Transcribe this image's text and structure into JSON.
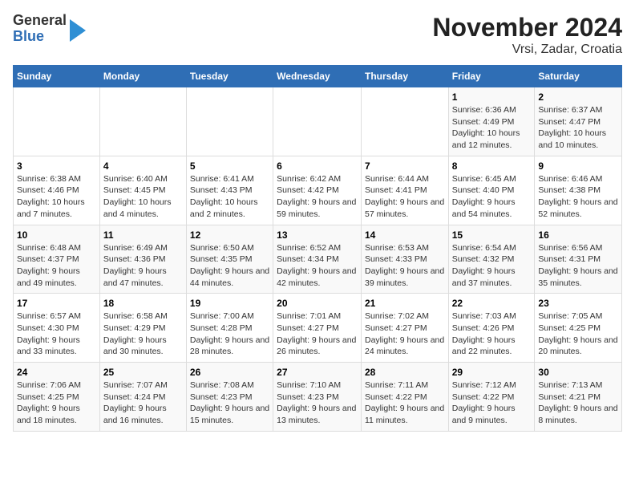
{
  "header": {
    "logo_general": "General",
    "logo_blue": "Blue",
    "title": "November 2024",
    "subtitle": "Vrsi, Zadar, Croatia"
  },
  "calendar": {
    "days_of_week": [
      "Sunday",
      "Monday",
      "Tuesday",
      "Wednesday",
      "Thursday",
      "Friday",
      "Saturday"
    ],
    "weeks": [
      [
        {
          "day": "",
          "info": ""
        },
        {
          "day": "",
          "info": ""
        },
        {
          "day": "",
          "info": ""
        },
        {
          "day": "",
          "info": ""
        },
        {
          "day": "",
          "info": ""
        },
        {
          "day": "1",
          "info": "Sunrise: 6:36 AM\nSunset: 4:49 PM\nDaylight: 10 hours and 12 minutes."
        },
        {
          "day": "2",
          "info": "Sunrise: 6:37 AM\nSunset: 4:47 PM\nDaylight: 10 hours and 10 minutes."
        }
      ],
      [
        {
          "day": "3",
          "info": "Sunrise: 6:38 AM\nSunset: 4:46 PM\nDaylight: 10 hours and 7 minutes."
        },
        {
          "day": "4",
          "info": "Sunrise: 6:40 AM\nSunset: 4:45 PM\nDaylight: 10 hours and 4 minutes."
        },
        {
          "day": "5",
          "info": "Sunrise: 6:41 AM\nSunset: 4:43 PM\nDaylight: 10 hours and 2 minutes."
        },
        {
          "day": "6",
          "info": "Sunrise: 6:42 AM\nSunset: 4:42 PM\nDaylight: 9 hours and 59 minutes."
        },
        {
          "day": "7",
          "info": "Sunrise: 6:44 AM\nSunset: 4:41 PM\nDaylight: 9 hours and 57 minutes."
        },
        {
          "day": "8",
          "info": "Sunrise: 6:45 AM\nSunset: 4:40 PM\nDaylight: 9 hours and 54 minutes."
        },
        {
          "day": "9",
          "info": "Sunrise: 6:46 AM\nSunset: 4:38 PM\nDaylight: 9 hours and 52 minutes."
        }
      ],
      [
        {
          "day": "10",
          "info": "Sunrise: 6:48 AM\nSunset: 4:37 PM\nDaylight: 9 hours and 49 minutes."
        },
        {
          "day": "11",
          "info": "Sunrise: 6:49 AM\nSunset: 4:36 PM\nDaylight: 9 hours and 47 minutes."
        },
        {
          "day": "12",
          "info": "Sunrise: 6:50 AM\nSunset: 4:35 PM\nDaylight: 9 hours and 44 minutes."
        },
        {
          "day": "13",
          "info": "Sunrise: 6:52 AM\nSunset: 4:34 PM\nDaylight: 9 hours and 42 minutes."
        },
        {
          "day": "14",
          "info": "Sunrise: 6:53 AM\nSunset: 4:33 PM\nDaylight: 9 hours and 39 minutes."
        },
        {
          "day": "15",
          "info": "Sunrise: 6:54 AM\nSunset: 4:32 PM\nDaylight: 9 hours and 37 minutes."
        },
        {
          "day": "16",
          "info": "Sunrise: 6:56 AM\nSunset: 4:31 PM\nDaylight: 9 hours and 35 minutes."
        }
      ],
      [
        {
          "day": "17",
          "info": "Sunrise: 6:57 AM\nSunset: 4:30 PM\nDaylight: 9 hours and 33 minutes."
        },
        {
          "day": "18",
          "info": "Sunrise: 6:58 AM\nSunset: 4:29 PM\nDaylight: 9 hours and 30 minutes."
        },
        {
          "day": "19",
          "info": "Sunrise: 7:00 AM\nSunset: 4:28 PM\nDaylight: 9 hours and 28 minutes."
        },
        {
          "day": "20",
          "info": "Sunrise: 7:01 AM\nSunset: 4:27 PM\nDaylight: 9 hours and 26 minutes."
        },
        {
          "day": "21",
          "info": "Sunrise: 7:02 AM\nSunset: 4:27 PM\nDaylight: 9 hours and 24 minutes."
        },
        {
          "day": "22",
          "info": "Sunrise: 7:03 AM\nSunset: 4:26 PM\nDaylight: 9 hours and 22 minutes."
        },
        {
          "day": "23",
          "info": "Sunrise: 7:05 AM\nSunset: 4:25 PM\nDaylight: 9 hours and 20 minutes."
        }
      ],
      [
        {
          "day": "24",
          "info": "Sunrise: 7:06 AM\nSunset: 4:25 PM\nDaylight: 9 hours and 18 minutes."
        },
        {
          "day": "25",
          "info": "Sunrise: 7:07 AM\nSunset: 4:24 PM\nDaylight: 9 hours and 16 minutes."
        },
        {
          "day": "26",
          "info": "Sunrise: 7:08 AM\nSunset: 4:23 PM\nDaylight: 9 hours and 15 minutes."
        },
        {
          "day": "27",
          "info": "Sunrise: 7:10 AM\nSunset: 4:23 PM\nDaylight: 9 hours and 13 minutes."
        },
        {
          "day": "28",
          "info": "Sunrise: 7:11 AM\nSunset: 4:22 PM\nDaylight: 9 hours and 11 minutes."
        },
        {
          "day": "29",
          "info": "Sunrise: 7:12 AM\nSunset: 4:22 PM\nDaylight: 9 hours and 9 minutes."
        },
        {
          "day": "30",
          "info": "Sunrise: 7:13 AM\nSunset: 4:21 PM\nDaylight: 9 hours and 8 minutes."
        }
      ]
    ]
  }
}
